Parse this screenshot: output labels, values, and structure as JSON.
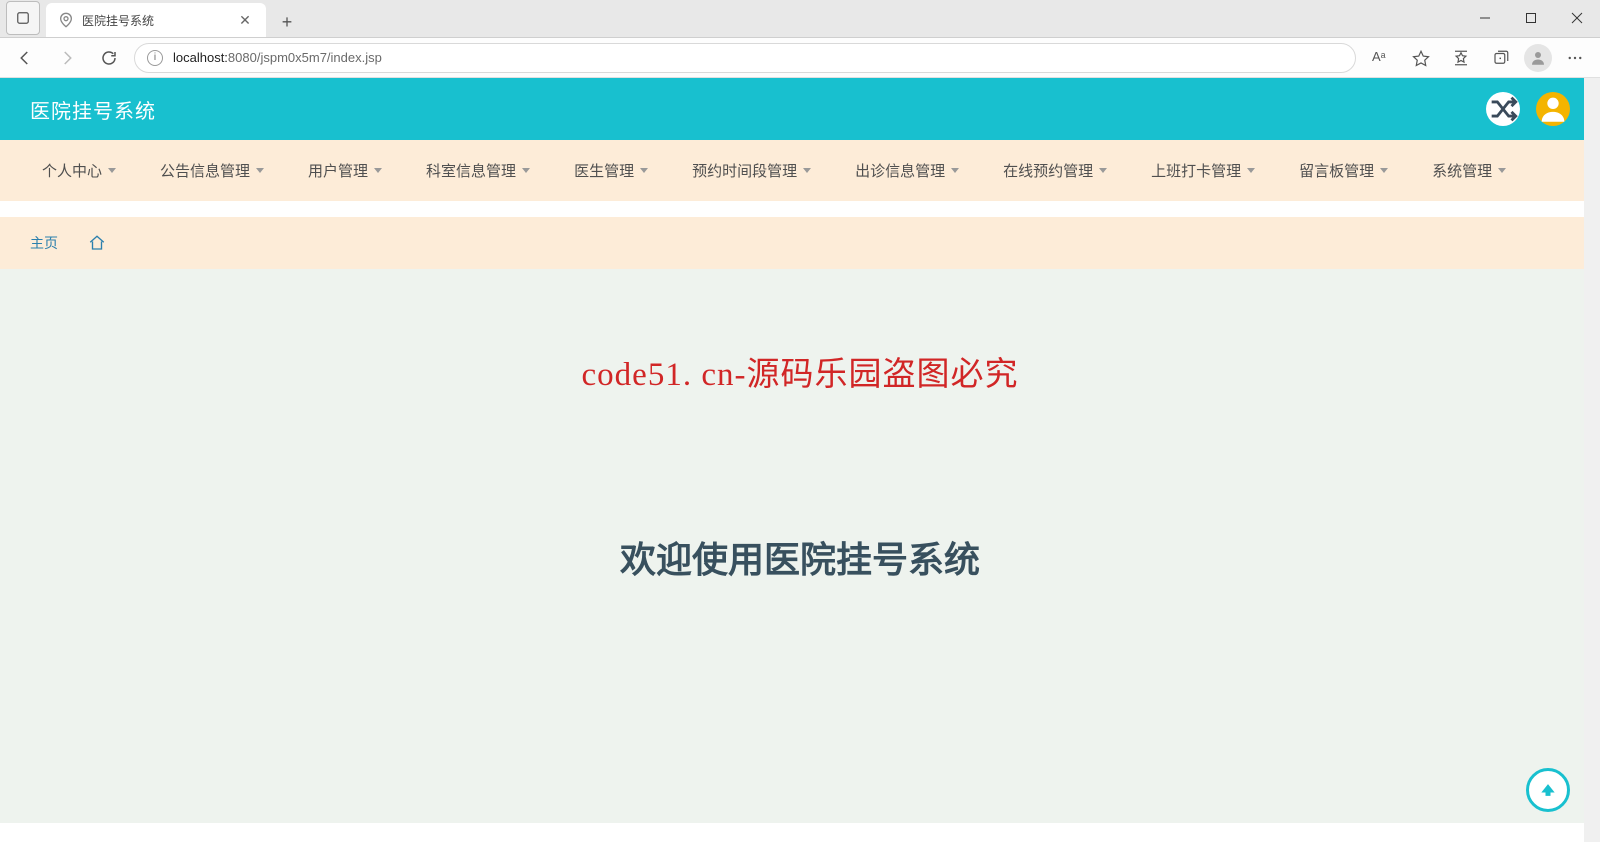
{
  "browser": {
    "tab_title": "医院挂号系统",
    "url_host": "localhost:",
    "url_port_path": "8080/jspm0x5m7/index.jsp",
    "text_size_label": "Aᵃ"
  },
  "header": {
    "title": "医院挂号系统"
  },
  "nav": {
    "items": [
      "个人中心",
      "公告信息管理",
      "用户管理",
      "科室信息管理",
      "医生管理",
      "预约时间段管理",
      "出诊信息管理",
      "在线预约管理",
      "上班打卡管理",
      "留言板管理",
      "系统管理"
    ]
  },
  "breadcrumb": {
    "home_label": "主页"
  },
  "body": {
    "watermark": "code51. cn-源码乐园盗图必究",
    "welcome": "欢迎使用医院挂号系统"
  }
}
